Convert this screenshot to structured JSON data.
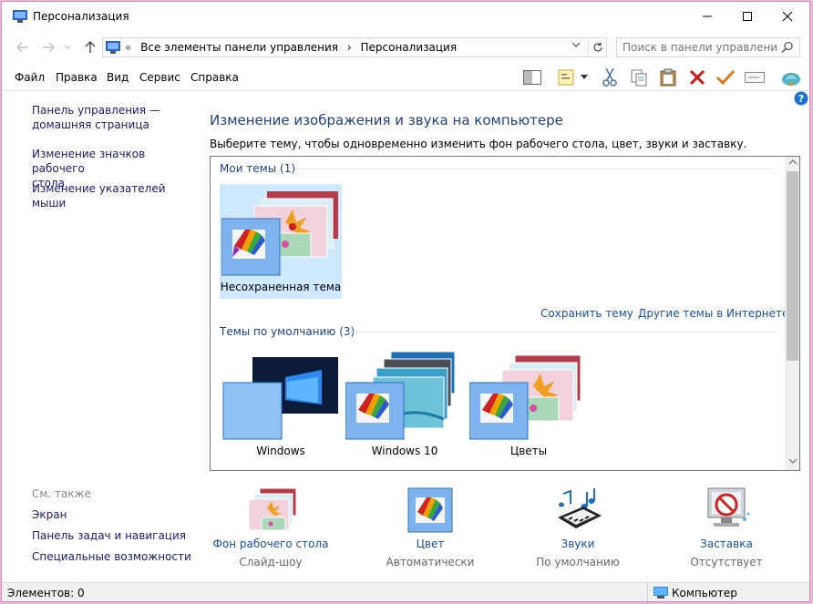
{
  "window": {
    "title": "Персонализация",
    "minimize": "minimize",
    "maximize": "maximize",
    "close": "close"
  },
  "address": {
    "prefix": "«",
    "crumbs": [
      "Все элементы панели управления",
      "›",
      "Персонализация"
    ],
    "search_placeholder": "Поиск в панели управления"
  },
  "menu": [
    "Файл",
    "Правка",
    "Вид",
    "Сервис",
    "Справка"
  ],
  "toolbar_icons": [
    "pane-icon",
    "properties-icon",
    "cut-icon",
    "copy-icon",
    "paste-icon",
    "delete-icon",
    "check-icon",
    "rename-icon",
    "shell-icon"
  ],
  "left": {
    "home": "Панель управления —\nдомашняя страница",
    "icons": "Изменение значков рабочего\nстола",
    "pointers": "Изменение указателей мыши",
    "see_also": "См. также",
    "screen": "Экран",
    "taskbar": "Панель задач и навигация",
    "accessibility": "Специальные возможности"
  },
  "main": {
    "heading": "Изменение изображения и звука на компьютере",
    "subheading": "Выберите тему, чтобы одновременно изменить фон рабочего стола, цвет, звуки и заставку.",
    "my_themes": "Мои темы (1)",
    "unsaved": "Несохраненная тема",
    "save_theme": "Сохранить тему",
    "more_online": "Другие темы в Интернете",
    "default_themes": "Темы по умолчанию (3)",
    "default_list": [
      "Windows",
      "Windows 10",
      "Цветы"
    ]
  },
  "tiles": [
    {
      "label": "Фон рабочего стола",
      "sub": "Слайд-шоу"
    },
    {
      "label": "Цвет",
      "sub": "Автоматически"
    },
    {
      "label": "Звуки",
      "sub": "По умолчанию"
    },
    {
      "label": "Заставка",
      "sub": "Отсутствует"
    }
  ],
  "status": {
    "items": "Элементов: 0",
    "location": "Компьютер"
  },
  "colors": {
    "heading": "#1e3f84",
    "link": "#1a4fa3",
    "selection": "#cde8ff"
  }
}
